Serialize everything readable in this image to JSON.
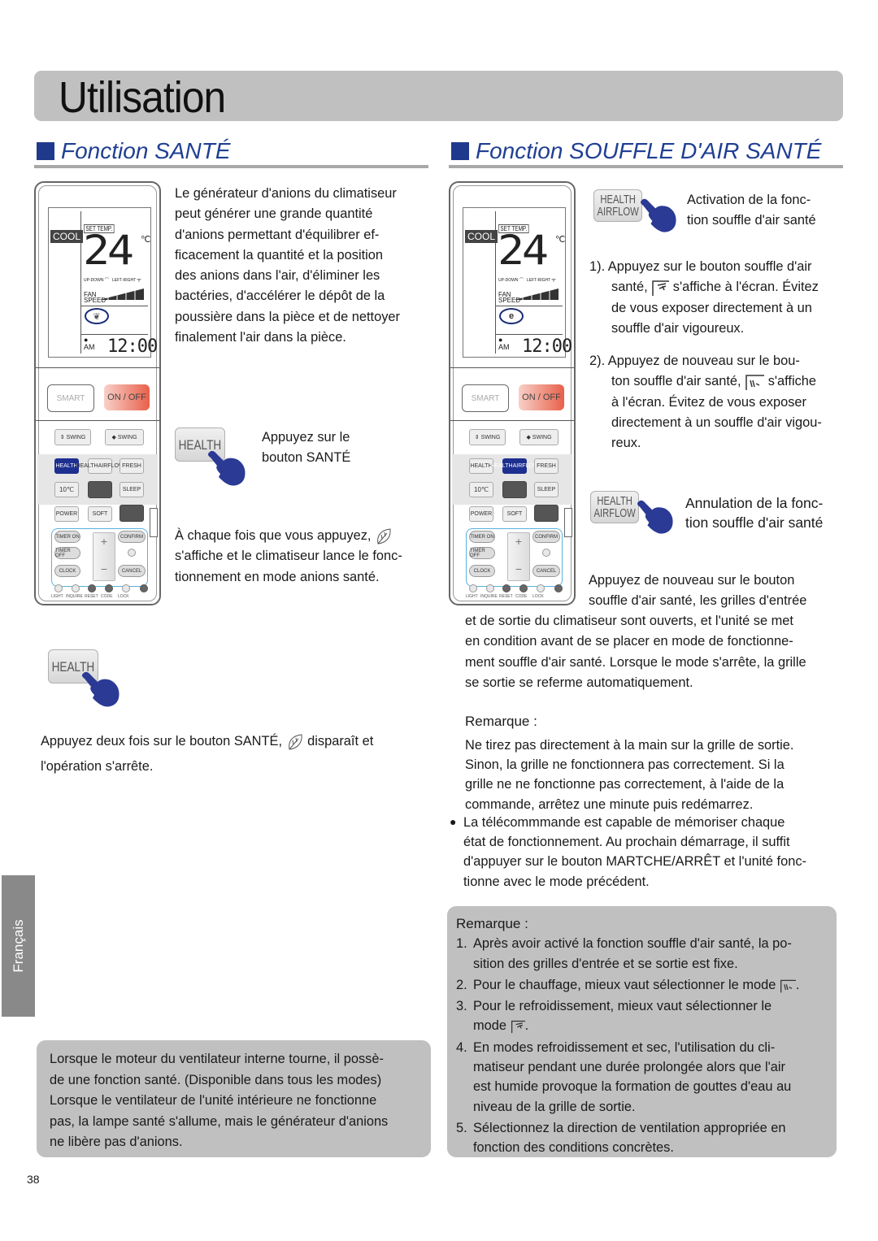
{
  "page": {
    "title": "Utilisation",
    "page_number": "38",
    "language_tab": "Français"
  },
  "left_section": {
    "heading": "Fonction SANTÉ",
    "intro_lines": [
      "Le générateur d'anions du climatiseur",
      "peut générer une grande quantité",
      "d'anions permettant d'équilibrer ef-",
      "ficacement la quantité et la position",
      "des anions dans l'air, d'éliminer les",
      "bactéries, d'accélérer le dépôt de la",
      "poussière dans la pièce et de nettoyer",
      "finalement l'air dans la pièce."
    ],
    "press_button_label": "HEALTH",
    "press_instruction_lines": [
      "Appuyez sur le",
      "bouton SANTÉ"
    ],
    "each_press_line1": "À chaque fois que vous appuyez,",
    "each_press_line2": "s'affiche et le climatiseur lance le fonc-",
    "each_press_line3": "tionnement en mode anions santé.",
    "press_twice_button_label": "HEALTH",
    "press_twice_line1_a": "Appuyez deux fois sur le bouton SANTÉ,",
    "press_twice_line1_b": "disparaît et",
    "press_twice_line2": "l'opération s'arrête.",
    "note_lines": [
      "Lorsque le moteur du ventilateur interne tourne, il possè-",
      "de une fonction santé. (Disponible dans tous les modes)",
      "Lorsque le ventilateur de l'unité intérieure ne fonctionne",
      "pas, la lampe santé s'allume, mais le générateur d'anions",
      "ne libère pas d'anions."
    ]
  },
  "right_section": {
    "heading": "Fonction SOUFFLE D'AIR SANTÉ",
    "button_label_line1": "HEALTH",
    "button_label_line2": "AIRFLOW",
    "activation_lines": [
      "Activation de la fonc-",
      "tion souffle d'air santé"
    ],
    "step1": {
      "num": "1).",
      "line1": "Appuyez sur le bouton souffle d'air",
      "line2_a": "santé,",
      "line2_b": "s'affiche à l'écran. Évitez",
      "line3": "de vous exposer directement à un",
      "line4": "souffle d'air vigoureux."
    },
    "step2": {
      "num": "2).",
      "line1": "Appuyez de nouveau sur le bou-",
      "line2_a": "ton souffle d'air santé,",
      "line2_b": "s'affiche",
      "line3": "à l'écran. Évitez de vous exposer",
      "line4": "directement à un souffle d'air vigou-",
      "line5": "reux."
    },
    "cancel_lines": [
      "Annulation de la fonc-",
      "tion souffle d'air santé"
    ],
    "cancel_desc_lines": [
      "Appuyez de nouveau sur le bouton",
      "souffle d'air santé, les grilles d'entrée",
      "et de sortie du climatiseur sont ouverts, et l'unité se met",
      "en condition avant de se placer en mode de fonctionne-",
      "ment souffle d'air santé. Lorsque le mode s'arrête, la grille",
      "se sortie se referme automatiquement."
    ],
    "remark1": {
      "title": "Remarque :",
      "lines": [
        "Ne tirez pas directement à la main sur la grille de sortie.",
        "Sinon, la grille ne fonctionnera pas correctement. Si la",
        "grille ne ne fonctionne pas correctement, à l'aide de la",
        "commande, arrêtez une minute puis redémarrez."
      ],
      "bullet_lines": [
        "La télécommmande est capable de mémoriser chaque",
        "état de fonctionnement. Au prochain démarrage, il suffit",
        "d'appuyer sur le bouton MARTCHE/ARRÊT et l'unité fonc-",
        "tionne avec le mode précédent."
      ]
    },
    "remark2": {
      "title": "Remarque :",
      "items": [
        {
          "num": "1.",
          "lines": [
            "Après avoir activé la fonction souffle d'air santé, la po-",
            "sition des grilles d'entrée et se sortie est fixe."
          ]
        },
        {
          "num": "2.",
          "lines": [
            "Pour le chauffage, mieux vaut sélectionner le mode"
          ]
        },
        {
          "num": "3.",
          "lines": [
            "Pour le refroidissement, mieux vaut sélectionner le",
            "mode"
          ]
        },
        {
          "num": "4.",
          "lines": [
            "En modes refroidissement et sec, l'utilisation du cli-",
            "matiseur pendant une durée prolongée alors que l'air",
            "est humide provoque la formation de gouttes d'eau au",
            "niveau de la grille de sortie."
          ]
        },
        {
          "num": "5.",
          "lines": [
            "Sélectionnez la direction de ventilation appropriée en",
            "fonction des conditions concrètes."
          ]
        }
      ]
    }
  },
  "remote": {
    "mode": "COOL",
    "set_temp_label": "SET TEMP.",
    "temperature": "24",
    "temp_unit": "℃",
    "updown_label": "UP-DOWN",
    "leftright_label": "LEFT-RIGHT",
    "fan_label_1": "FAN",
    "fan_label_2": "SPEED",
    "am_label": "AM",
    "clock": "12:00",
    "buttons": {
      "smart": "SMART",
      "onoff": "ON / OFF",
      "swing_v": "⇕ SWING",
      "swing_h": "◆ SWING",
      "health": "HEALTH",
      "health_airflow_1": "HEALTH",
      "health_airflow_2": "AIRFLOW",
      "fresh": "FRESH",
      "ten_c": "10℃",
      "sleep": "SLEEP",
      "power": "POWER",
      "soft": "SOFT",
      "timer_on": "TIMER ON",
      "timer_off": "TIMER OFF",
      "clock": "CLOCK",
      "confirm": "CONFIRM",
      "cancel": "CANCEL",
      "plus": "+",
      "minus": "−"
    },
    "leds": [
      "LIGHT",
      "INQUIRE",
      "RESET",
      "CODE",
      "LOCK"
    ]
  },
  "colors": {
    "accent_blue": "#1f3f93",
    "hand_blue": "#2b3a95",
    "box_grey": "#c0c0c0",
    "onoff_red": "#e8604a"
  }
}
